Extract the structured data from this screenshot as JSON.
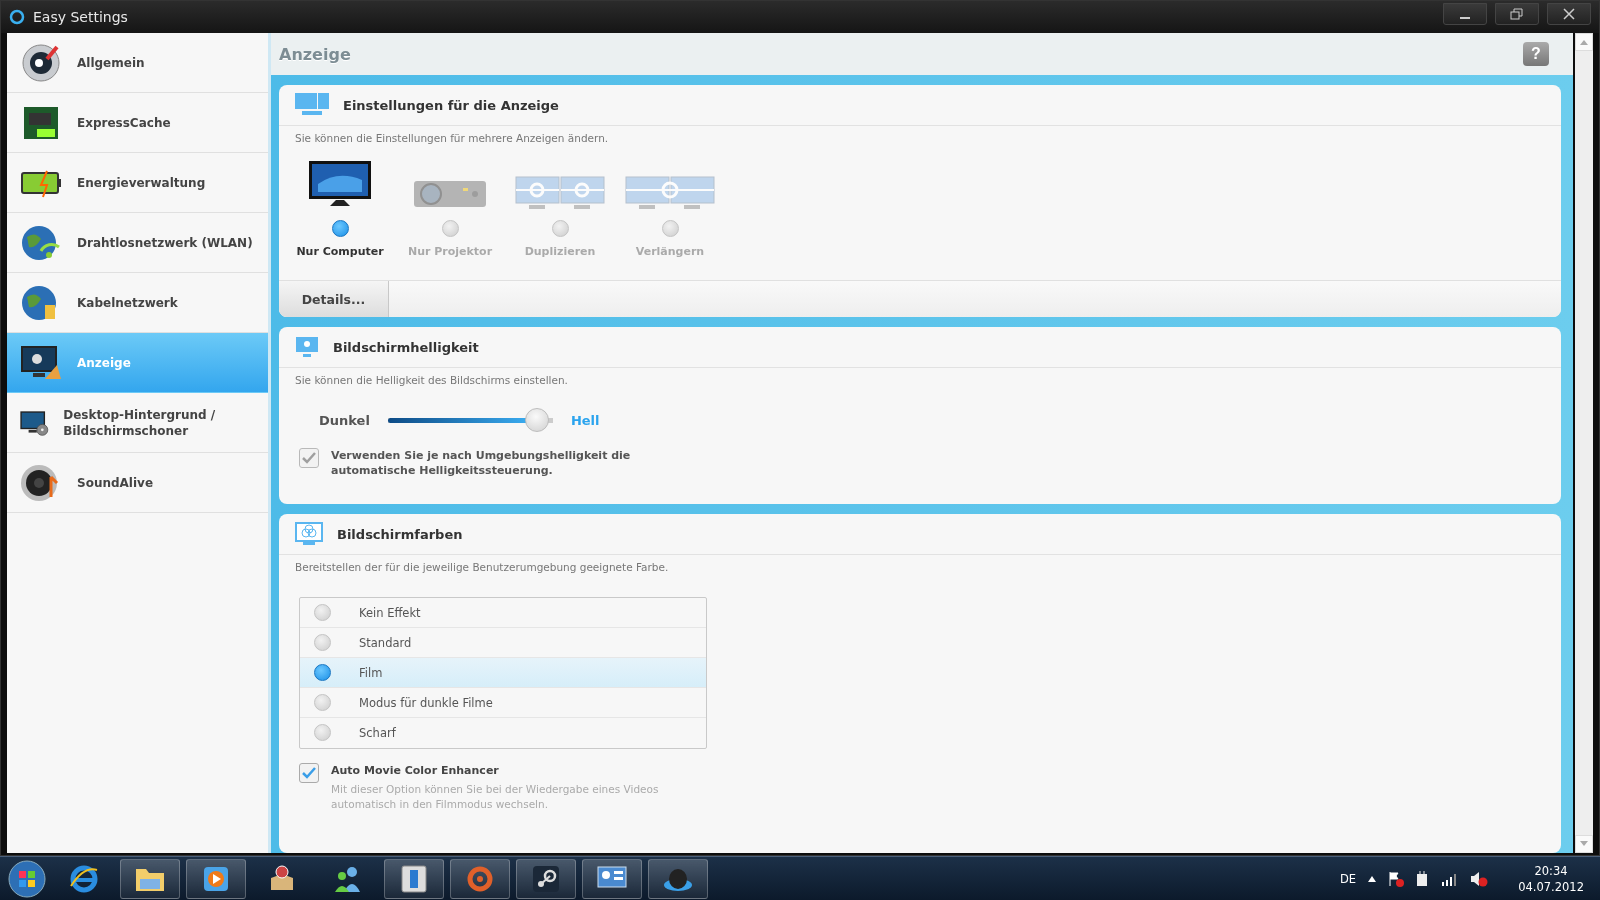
{
  "window": {
    "title": "Easy Settings"
  },
  "sidebar": {
    "items": [
      {
        "label": "Allgemein",
        "selected": false
      },
      {
        "label": "ExpressCache",
        "selected": false
      },
      {
        "label": "Energieverwaltung",
        "selected": false
      },
      {
        "label": "Drahtlosnetzwerk (WLAN)",
        "selected": false
      },
      {
        "label": "Kabelnetzwerk",
        "selected": false
      },
      {
        "label": "Anzeige",
        "selected": true
      },
      {
        "label": "Desktop-Hintergrund / Bildschirmschoner",
        "selected": false
      },
      {
        "label": "SoundAlive",
        "selected": false
      }
    ]
  },
  "page": {
    "title": "Anzeige",
    "help": "?"
  },
  "display_settings": {
    "title": "Einstellungen für die Anzeige",
    "description": "Sie können die Einstellungen für mehrere Anzeigen ändern.",
    "modes": [
      {
        "label": "Nur Computer",
        "kind": "monitor",
        "selected": true
      },
      {
        "label": "Nur Projektor",
        "kind": "projector",
        "selected": false
      },
      {
        "label": "Duplizieren",
        "kind": "duplicate",
        "selected": false
      },
      {
        "label": "Verlängern",
        "kind": "extend",
        "selected": false
      }
    ],
    "details_button": "Details..."
  },
  "brightness": {
    "title": "Bildschirmhelligkeit",
    "description": "Sie können die Helligkeit des Bildschirms einstellen.",
    "low_label": "Dunkel",
    "high_label": "Hell",
    "level": 0.9,
    "auto": {
      "label": "Verwenden Sie je nach Umgebungshelligkeit die automatische Helligkeitssteuerung.",
      "checked": true,
      "disabled": true
    }
  },
  "colors": {
    "title": "Bildschirmfarben",
    "description": "Bereitstellen der für die jeweilige Benutzerumgebung geeignete Farbe.",
    "options": [
      {
        "label": "Kein Effekt",
        "selected": false
      },
      {
        "label": "Standard",
        "selected": false
      },
      {
        "label": "Film",
        "selected": true
      },
      {
        "label": "Modus für dunkle Filme",
        "selected": false
      },
      {
        "label": "Scharf",
        "selected": false
      }
    ],
    "enhancer": {
      "label": "Auto Movie Color Enhancer",
      "description": "Mit dieser Option können Sie bei der Wiedergabe eines Videos automatisch in den Filmmodus wechseln.",
      "checked": true,
      "disabled": false
    }
  },
  "taskbar": {
    "language": "DE",
    "time": "20:34",
    "date": "04.07.2012"
  }
}
